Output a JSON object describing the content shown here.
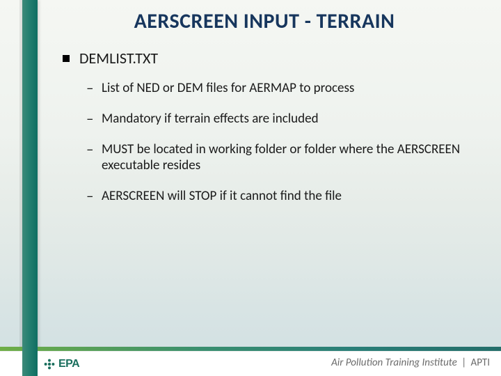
{
  "title": "AERSCREEN INPUT - TERRAIN",
  "content": {
    "lvl1": {
      "text": "DEMLIST.TXT"
    },
    "lvl2": [
      {
        "text": "List of NED or DEM files for AERMAP to process"
      },
      {
        "text": "Mandatory if terrain effects are included"
      },
      {
        "text": "MUST be located in working folder or folder where the AERSCREEN executable resides"
      },
      {
        "text": "AERSCREEN will STOP if it cannot find the file"
      }
    ]
  },
  "footer": {
    "epa_text": "EPA",
    "apti_full": "Air Pollution Training Institute",
    "apti_pipe": "|",
    "apti_abbr": "APTI"
  }
}
